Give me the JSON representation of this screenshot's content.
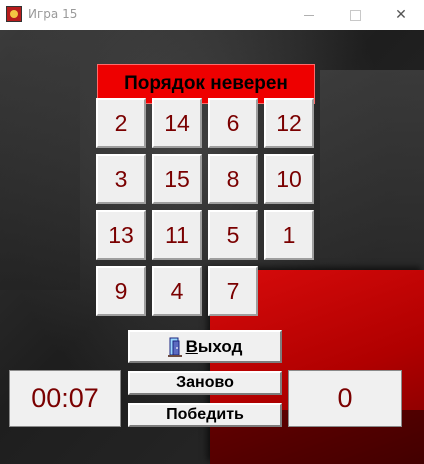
{
  "window": {
    "title": "Игра 15",
    "minimize_symbol": "—",
    "maximize_symbol": "☐",
    "close_symbol": "✕"
  },
  "status": {
    "text": "Порядок неверен",
    "color": "#ee0000"
  },
  "board": {
    "rows": [
      [
        "2",
        "14",
        "6",
        "12"
      ],
      [
        "3",
        "15",
        "8",
        "10"
      ],
      [
        "13",
        "11",
        "5",
        "1"
      ],
      [
        "9",
        "4",
        "7",
        ""
      ]
    ]
  },
  "buttons": {
    "exit": "Выход",
    "exit_access_key": "В",
    "exit_rest": "ыход",
    "exit_icon": "door-exit-icon",
    "restart": "Заново",
    "win": "Победить"
  },
  "timer": {
    "value": "00:07"
  },
  "moves": {
    "value": "0"
  },
  "colors": {
    "tile_text": "#7a0000",
    "status_bg": "#ee0000"
  }
}
